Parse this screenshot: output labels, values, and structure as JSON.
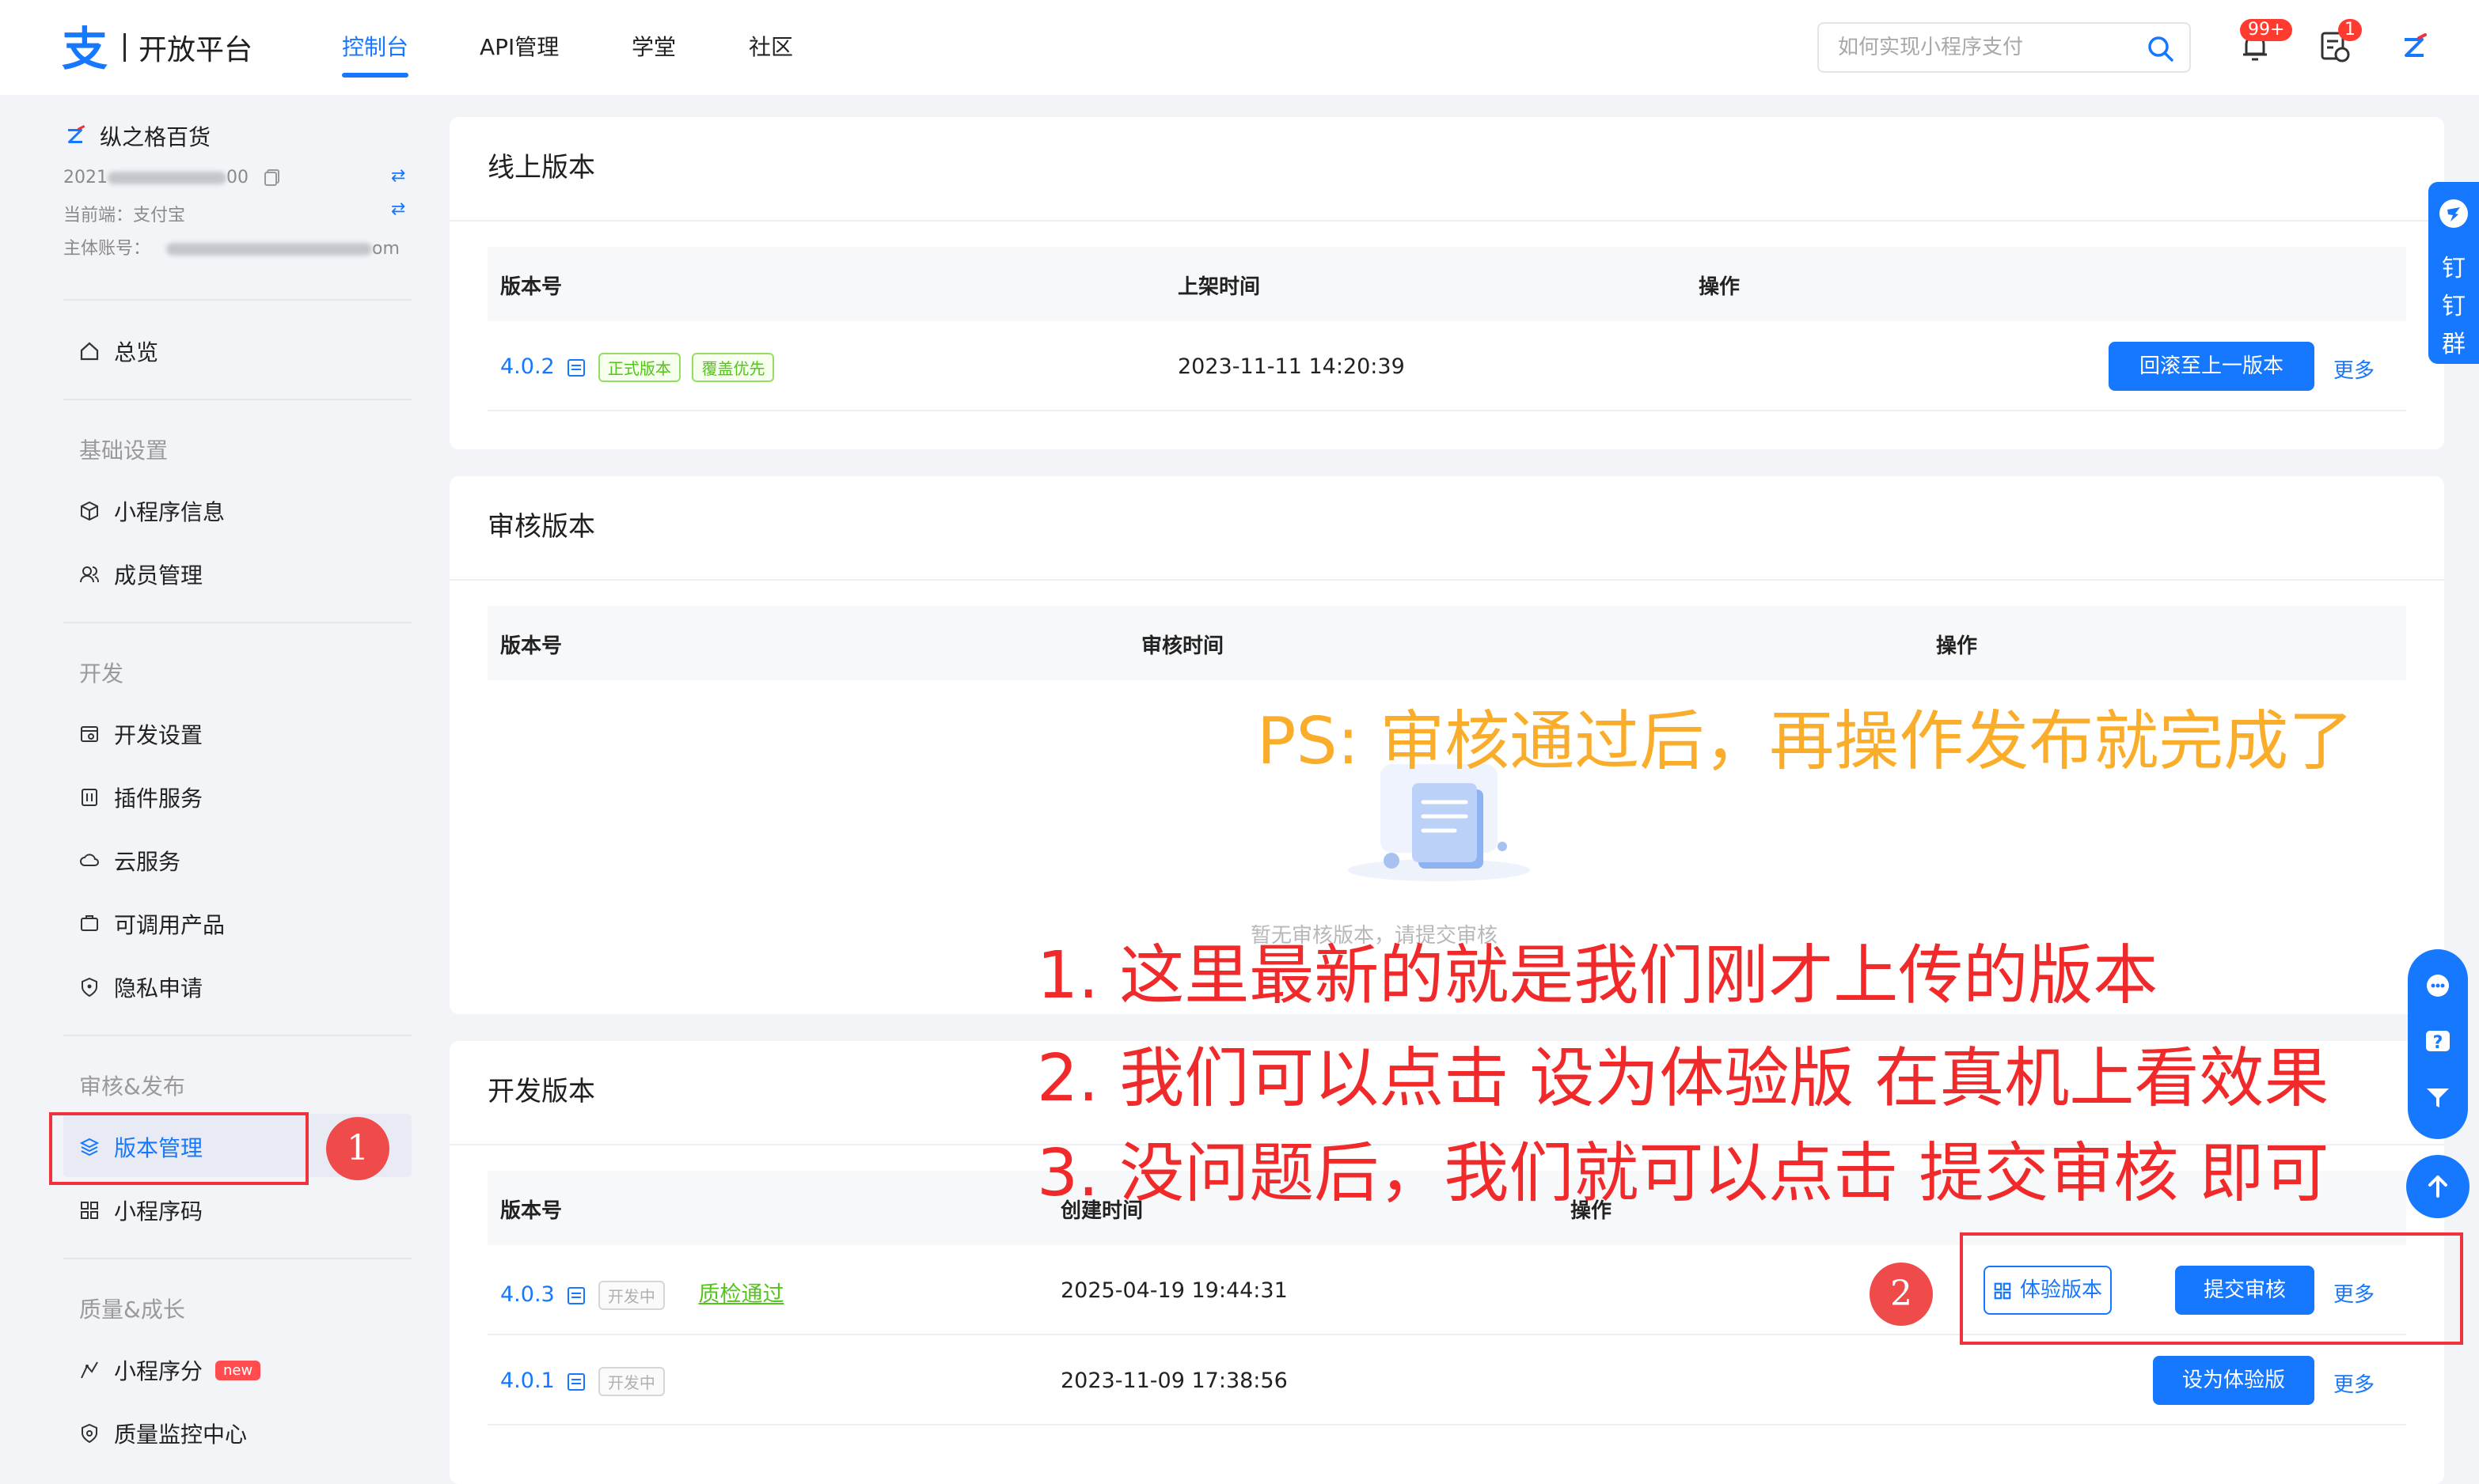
{
  "header": {
    "logo_text": "开放平台",
    "nav": [
      "控制台",
      "API管理",
      "学堂",
      "社区"
    ],
    "search_placeholder": "如何实现小程序支付",
    "bell_badge": "99+",
    "tasks_badge": "1"
  },
  "sidebar": {
    "account_name": "纵之格百货",
    "app_id_prefix": "2021",
    "app_id_suffix": "00",
    "client_label": "当前端：支付宝",
    "owner_label": "主体账号：",
    "owner_suffix": "om",
    "overview": "总览",
    "groups": {
      "basic": "基础设置",
      "dev": "开发",
      "publish": "审核&发布",
      "quality": "质量&成长"
    },
    "items": {
      "miniapp_info": "小程序信息",
      "members": "成员管理",
      "dev_settings": "开发设置",
      "plugins": "插件服务",
      "cloud": "云服务",
      "products": "可调用产品",
      "privacy": "隐私申请",
      "versions": "版本管理",
      "qrcode": "小程序码",
      "score": "小程序分",
      "monitor": "质量监控中心"
    },
    "new_badge": "new"
  },
  "online": {
    "title": "线上版本",
    "cols": [
      "版本号",
      "上架时间",
      "操作"
    ],
    "row": {
      "version": "4.0.2",
      "tag1": "正式版本",
      "tag2": "覆盖优先",
      "time": "2023-11-11 14:20:39",
      "action": "回滚至上一版本",
      "more": "更多"
    }
  },
  "review": {
    "title": "审核版本",
    "cols": [
      "版本号",
      "审核时间",
      "操作"
    ],
    "empty_text": "暂无审核版本，请提交审核"
  },
  "dev": {
    "title": "开发版本",
    "cols": [
      "版本号",
      "创建时间",
      "操作"
    ],
    "rows": [
      {
        "version": "4.0.3",
        "tag": "开发中",
        "qc": "质检通过",
        "time": "2025-04-19 19:44:31",
        "btn_trial": "体验版本",
        "btn_submit": "提交审核",
        "more": "更多"
      },
      {
        "version": "4.0.1",
        "tag": "开发中",
        "time": "2023-11-09 17:38:56",
        "btn_set_trial": "设为体验版",
        "more": "更多"
      }
    ]
  },
  "annotations": {
    "ps": "PS: 审核通过后，再操作发布就完成了",
    "line1": "1. 这里最新的就是我们刚才上传的版本",
    "line2": "2. 我们可以点击 设为体验版 在真机上看效果",
    "line3": "3. 没问题后，我们就可以点击 提交审核 即可",
    "marker1": "1",
    "marker2": "2"
  },
  "float": {
    "dingtalk_label": [
      "钉",
      "钉",
      "群"
    ]
  },
  "colors": {
    "accent": "#1677ff",
    "annotation_red": "#f02a2a",
    "annotation_orange": "#f9ad2b",
    "tag_green": "#52c41a"
  },
  "icons": [
    "alipay-logo",
    "search-icon",
    "bell-icon",
    "tasks-icon",
    "user-avatar-icon",
    "home-icon",
    "cube-icon",
    "users-icon",
    "settings-icon",
    "plugin-icon",
    "cloud-icon",
    "product-icon",
    "shield-icon",
    "layers-icon",
    "qrcode-icon",
    "score-icon",
    "monitor-icon",
    "doc-icon",
    "dingtalk-icon",
    "chat-icon",
    "help-icon",
    "feedback-icon",
    "arrow-up-icon"
  ]
}
